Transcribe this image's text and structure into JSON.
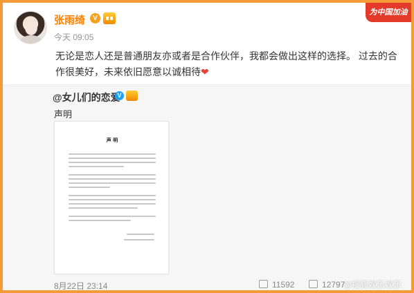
{
  "post": {
    "username": "张雨绮",
    "time": "今天 09:05",
    "text": "无论是恋人还是普通朋友亦或者是合作伙伴，我都会做出这样的选择。 过去的合作很美好，未来依旧愿意以诚相待",
    "heart": "❤"
  },
  "badges": {
    "v_label": "V"
  },
  "promo": {
    "label": "为中国加油"
  },
  "repost": {
    "author": "@女儿们的恋爱",
    "v_label": "V",
    "text": "声明",
    "doc_title": "声 明",
    "date": "8月22日 23:14",
    "reposts": "11592",
    "comments": "12797",
    "watermark": "@搜狐娱乐娱乐"
  },
  "colors": {
    "accent": "#ff8200",
    "border": "#f29b38",
    "promo": "#e33a2a"
  }
}
